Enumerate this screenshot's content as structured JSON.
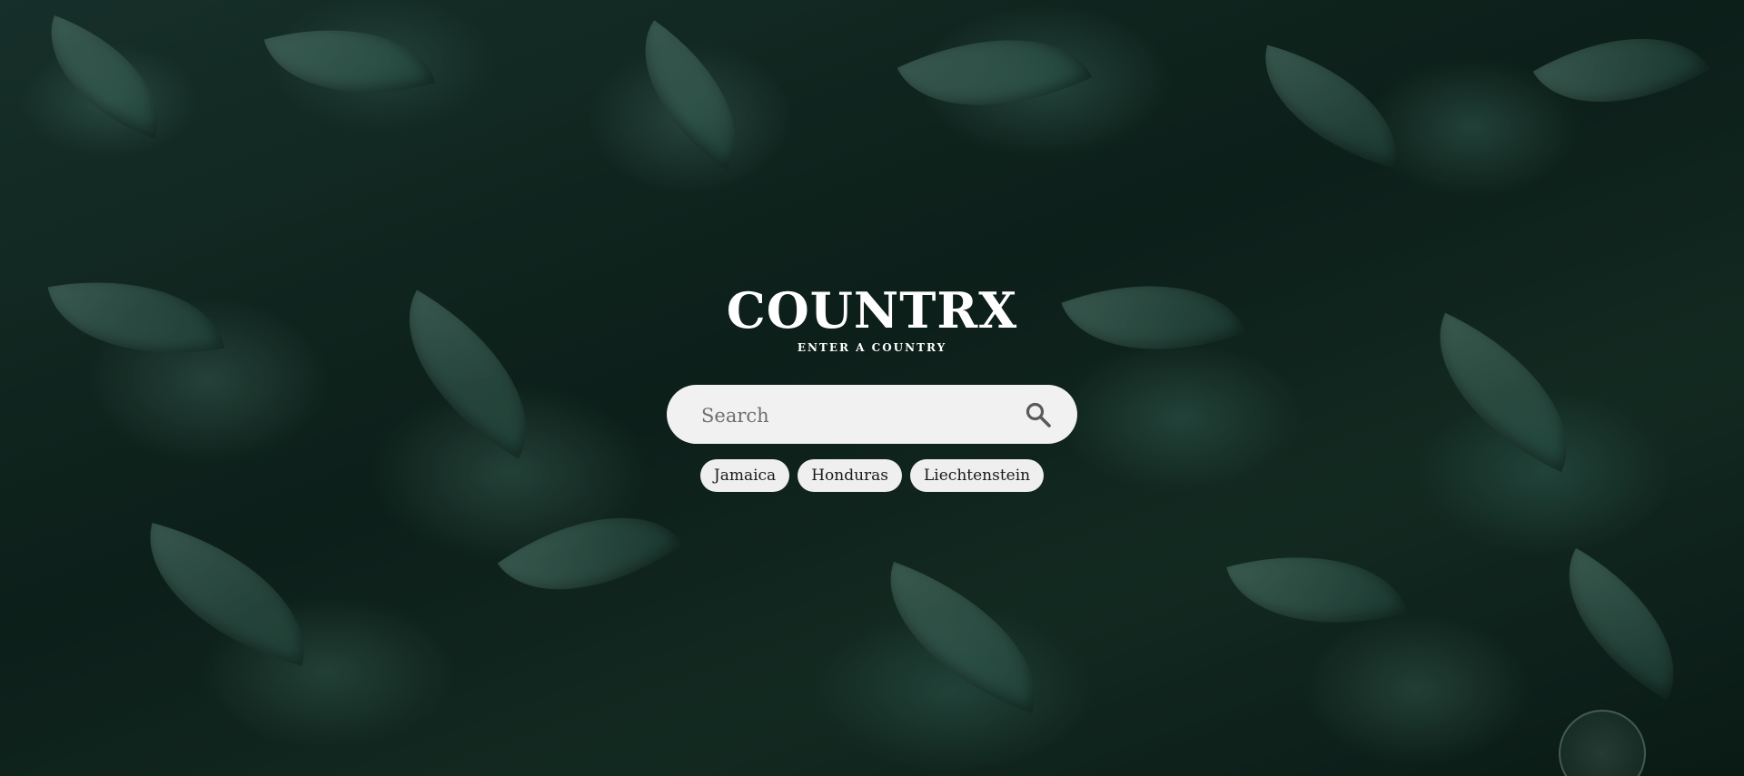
{
  "app": {
    "title": "COUNTRX",
    "subtitle": "ENTER A COUNTRY"
  },
  "search": {
    "placeholder": "Search",
    "value": "",
    "icon": "search-icon"
  },
  "suggestions": [
    {
      "label": "Jamaica"
    },
    {
      "label": "Honduras"
    },
    {
      "label": "Liechtenstein"
    }
  ],
  "colors": {
    "title": "#ffffff",
    "search_background": "#f1f1f1",
    "chip_background": "#efefef",
    "chip_text": "#1a1a1a",
    "background_dark": "#10261f"
  }
}
